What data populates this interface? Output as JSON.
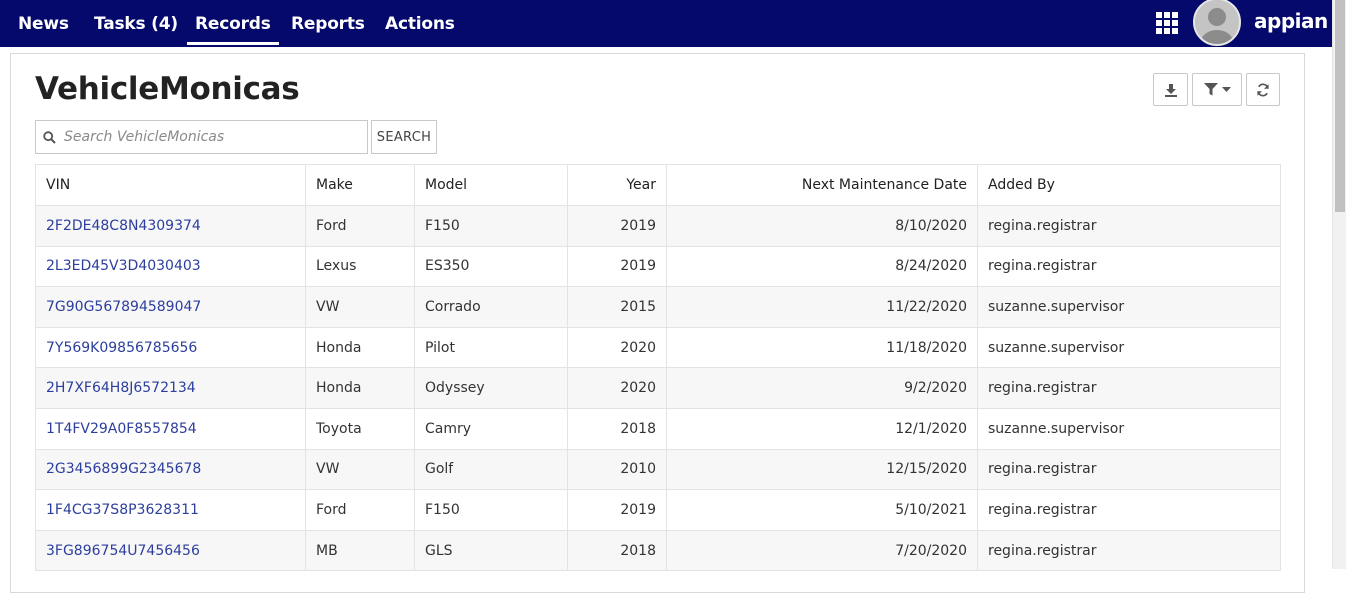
{
  "nav": {
    "tabs": [
      {
        "label": "News"
      },
      {
        "label": "Tasks (4)"
      },
      {
        "label": "Records",
        "active": true
      },
      {
        "label": "Reports"
      },
      {
        "label": "Actions"
      }
    ],
    "apps_icon": "grid-icon",
    "avatar_icon": "user-avatar",
    "logo": "appian"
  },
  "page": {
    "title": "VehicleMonicas",
    "toolbar_icons": [
      "download-icon",
      "filter-icon",
      "refresh-icon"
    ]
  },
  "search": {
    "placeholder": "Search VehicleMonicas",
    "value": "",
    "button_label": "SEARCH"
  },
  "table": {
    "headers": [
      "VIN",
      "Make",
      "Model",
      "Year",
      "Next Maintenance Date",
      "Added By"
    ],
    "rows": [
      [
        "2F2DE48C8N4309374",
        "Ford",
        "F150",
        "2019",
        "8/10/2020",
        "regina.registrar"
      ],
      [
        "2L3ED45V3D4030403",
        "Lexus",
        "ES350",
        "2019",
        "8/24/2020",
        "regina.registrar"
      ],
      [
        "7G90G567894589047",
        "VW",
        "Corrado",
        "2015",
        "11/22/2020",
        "suzanne.supervisor"
      ],
      [
        "7Y569K09856785656",
        "Honda",
        "Pilot",
        "2020",
        "11/18/2020",
        "suzanne.supervisor"
      ],
      [
        "2H7XF64H8J6572134",
        "Honda",
        "Odyssey",
        "2020",
        "9/2/2020",
        "regina.registrar"
      ],
      [
        "1T4FV29A0F8557854",
        "Toyota",
        "Camry",
        "2018",
        "12/1/2020",
        "suzanne.supervisor"
      ],
      [
        "2G3456899G2345678",
        "VW",
        "Golf",
        "2010",
        "12/15/2020",
        "regina.registrar"
      ],
      [
        "1F4CG37S8P3628311",
        "Ford",
        "F150",
        "2019",
        "5/10/2021",
        "regina.registrar"
      ],
      [
        "3FG896754U7456456",
        "MB",
        "GLS",
        "2018",
        "7/20/2020",
        "regina.registrar"
      ]
    ]
  },
  "colors": {
    "nav_bg": "#04096b",
    "link": "#2c3e9e",
    "stripe": "#f7f7f7"
  }
}
